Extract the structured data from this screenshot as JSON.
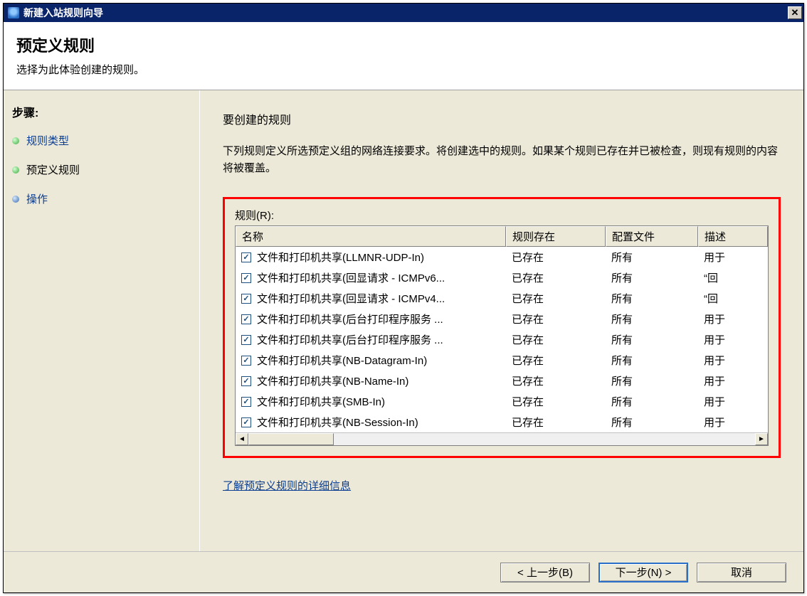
{
  "window": {
    "title": "新建入站规则向导"
  },
  "header": {
    "title": "预定义规则",
    "subtitle": "选择为此体验创建的规则。"
  },
  "sidebar": {
    "steps_label": "步骤:",
    "steps": [
      {
        "label": "规则类型",
        "state": "link"
      },
      {
        "label": "预定义规则",
        "state": "current"
      },
      {
        "label": "操作",
        "state": "link"
      }
    ]
  },
  "content": {
    "section_title": "要创建的规则",
    "instructions": "下列规则定义所选预定义组的网络连接要求。将创建选中的规则。如果某个规则已存在并已被检查，则现有规则的内容将被覆盖。",
    "rules_label": "规则(R):",
    "columns": {
      "name": "名称",
      "exists": "规则存在",
      "profile": "配置文件",
      "desc": "描述"
    },
    "rows": [
      {
        "checked": true,
        "name": "文件和打印机共享(LLMNR-UDP-In)",
        "exists": "已存在",
        "profile": "所有",
        "desc": "用于"
      },
      {
        "checked": true,
        "name": "文件和打印机共享(回显请求 - ICMPv6...",
        "exists": "已存在",
        "profile": "所有",
        "desc": "“回"
      },
      {
        "checked": true,
        "name": "文件和打印机共享(回显请求 - ICMPv4...",
        "exists": "已存在",
        "profile": "所有",
        "desc": "“回"
      },
      {
        "checked": true,
        "name": "文件和打印机共享(后台打印程序服务 ...",
        "exists": "已存在",
        "profile": "所有",
        "desc": "用于"
      },
      {
        "checked": true,
        "name": "文件和打印机共享(后台打印程序服务 ...",
        "exists": "已存在",
        "profile": "所有",
        "desc": "用于"
      },
      {
        "checked": true,
        "name": "文件和打印机共享(NB-Datagram-In)",
        "exists": "已存在",
        "profile": "所有",
        "desc": "用于"
      },
      {
        "checked": true,
        "name": "文件和打印机共享(NB-Name-In)",
        "exists": "已存在",
        "profile": "所有",
        "desc": "用于"
      },
      {
        "checked": true,
        "name": "文件和打印机共享(SMB-In)",
        "exists": "已存在",
        "profile": "所有",
        "desc": "用于"
      },
      {
        "checked": true,
        "name": "文件和打印机共享(NB-Session-In)",
        "exists": "已存在",
        "profile": "所有",
        "desc": "用于"
      }
    ],
    "learn_more": "了解预定义规则的详细信息"
  },
  "footer": {
    "back": "< 上一步(B)",
    "next": "下一步(N) >",
    "cancel": "取消"
  }
}
